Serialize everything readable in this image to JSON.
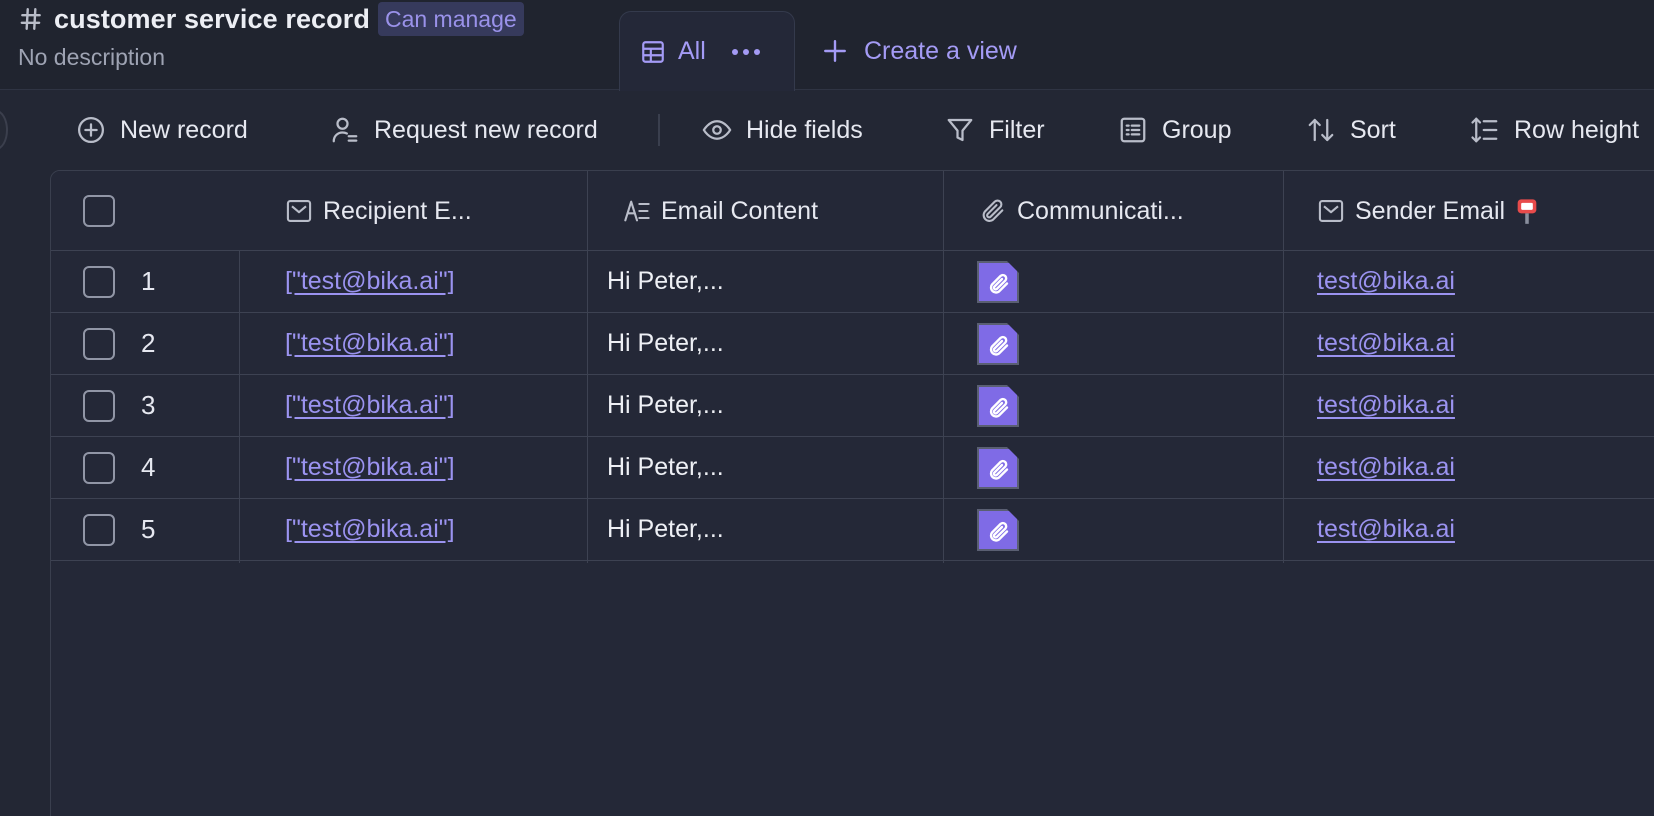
{
  "header": {
    "title": "customer service record",
    "permission_badge": "Can manage",
    "description": "No description",
    "view_tab": {
      "label": "All"
    },
    "create_view": "Create a view"
  },
  "toolbar": {
    "new_record": "New record",
    "request_new_record": "Request new record",
    "hide_fields": "Hide fields",
    "filter": "Filter",
    "group": "Group",
    "sort": "Sort",
    "row_height": "Row height"
  },
  "table": {
    "columns": [
      {
        "label": "Recipient E...",
        "icon": "email-field-icon"
      },
      {
        "label": "Email Content",
        "icon": "long-text-icon"
      },
      {
        "label": "Communicati...",
        "icon": "attachment-icon"
      },
      {
        "label": "Sender Email",
        "icon": "email-field-icon",
        "suffix_icon": "mailbox-emoji"
      }
    ],
    "rows": [
      {
        "num": "1",
        "recipient": "[\"test@bika.ai\"]",
        "content": "Hi Peter,...",
        "sender": "test@bika.ai"
      },
      {
        "num": "2",
        "recipient": "[\"test@bika.ai\"]",
        "content": "Hi Peter,...",
        "sender": "test@bika.ai"
      },
      {
        "num": "3",
        "recipient": "[\"test@bika.ai\"]",
        "content": "Hi Peter,...",
        "sender": "test@bika.ai"
      },
      {
        "num": "4",
        "recipient": "[\"test@bika.ai\"]",
        "content": "Hi Peter,...",
        "sender": "test@bika.ai"
      },
      {
        "num": "5",
        "recipient": "[\"test@bika.ai\"]",
        "content": "Hi Peter,...",
        "sender": "test@bika.ai"
      }
    ]
  },
  "colors": {
    "background": "#232734",
    "accent": "#9b93f0",
    "attachment": "#7f6be6"
  }
}
